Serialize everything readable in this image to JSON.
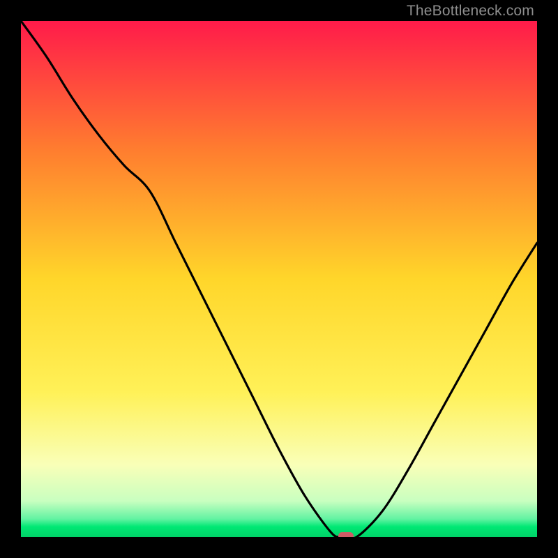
{
  "watermark": "TheBottleneck.com",
  "chart_data": {
    "type": "line",
    "x": [
      0,
      5,
      10,
      15,
      20,
      25,
      30,
      35,
      40,
      45,
      50,
      55,
      60,
      62,
      65,
      70,
      75,
      80,
      85,
      90,
      95,
      100
    ],
    "values": [
      100,
      93,
      85,
      78,
      72,
      67,
      57,
      47,
      37,
      27,
      17,
      8,
      1,
      0,
      0,
      5,
      13,
      22,
      31,
      40,
      49,
      57
    ],
    "title": "",
    "xlabel": "",
    "ylabel": "",
    "xlim": [
      0,
      100
    ],
    "ylim": [
      0,
      100
    ],
    "minimum_marker": {
      "x": 63,
      "y": 0,
      "color": "#cf5b66"
    },
    "background_gradient": {
      "top": "#ff1b4a",
      "mid_upper": "#ffbe20",
      "mid": "#fff158",
      "mid_lower": "#f5ffb0",
      "green": "#00e874",
      "bottom": "#00d56b"
    }
  }
}
